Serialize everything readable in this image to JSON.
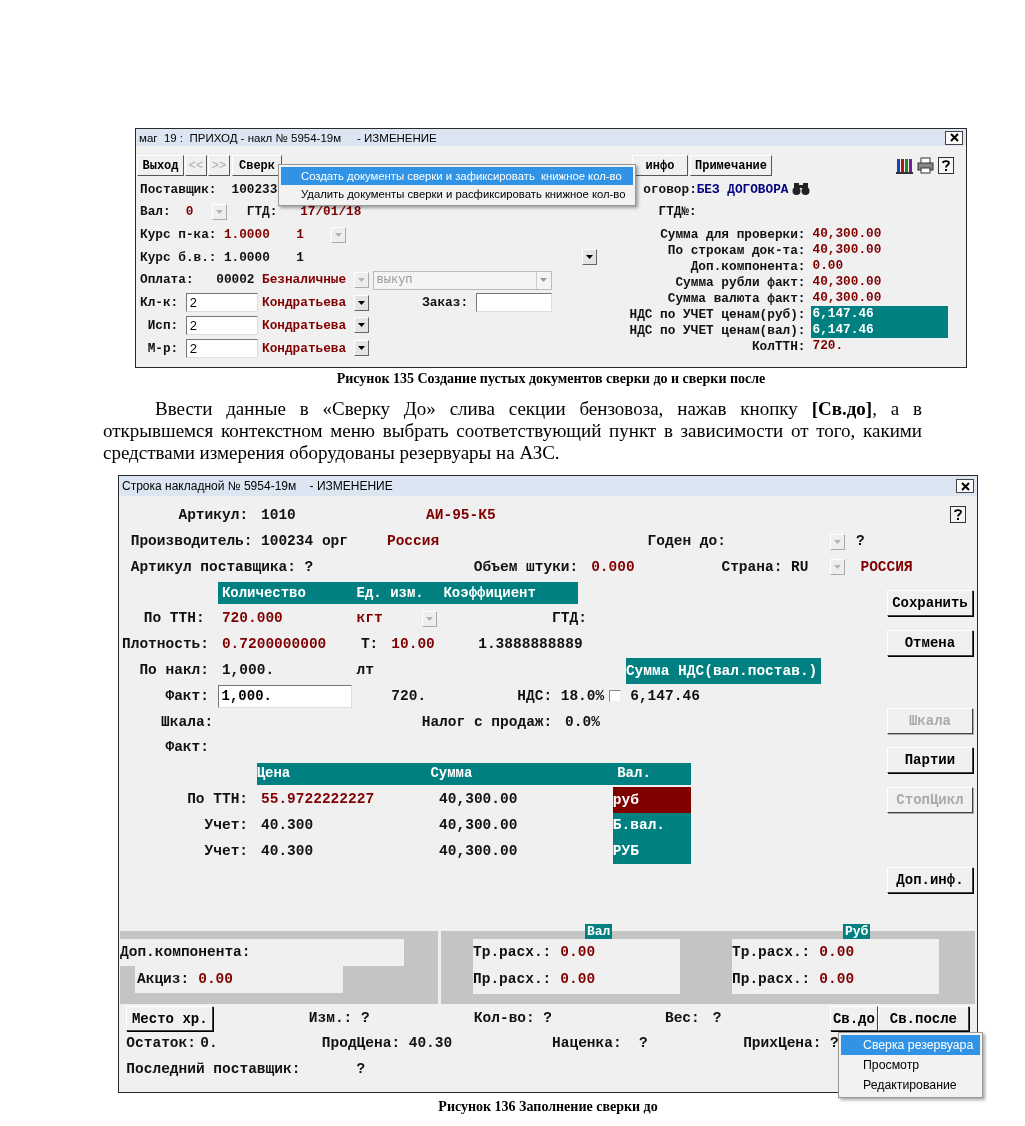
{
  "figure_1": {
    "window": {
      "title": "маг  19 :  ПРИХОД - накл № 5954-19м     - ИЗМЕНЕНИЕ"
    },
    "toolbar": [
      {
        "label": "Выход",
        "disabled": false
      },
      {
        "label": "<<",
        "disabled": true
      },
      {
        "label": ">>",
        "disabled": true
      },
      {
        "label": "Сверк",
        "disabled": false
      },
      {
        "label": "инфо",
        "disabled": false
      },
      {
        "label": "Примечание",
        "disabled": false
      }
    ],
    "context_menu": [
      {
        "label": "Создать документы сверки и зафиксировать  книжное кол-во",
        "selected": true
      },
      {
        "label": "Удалить документы сверки и расфиксировать книжное кол-во",
        "selected": false
      }
    ],
    "form_rows": [
      [
        {
          "kind": "label",
          "text": "Поставщик:"
        },
        {
          "kind": "value",
          "text": "100233"
        },
        {
          "kind": "label",
          "text": "оговор:"
        },
        {
          "kind": "emphasis",
          "text": "БЕЗ ДОГОВОРА"
        }
      ],
      [
        {
          "kind": "label",
          "text": "Вал:"
        },
        {
          "kind": "accent",
          "text": "0"
        },
        {
          "kind": "combo",
          "disabled": true
        },
        {
          "kind": "label",
          "text": "ГТД:"
        },
        {
          "kind": "accent",
          "text": "17/01/18"
        },
        {
          "kind": "label",
          "text": "ГТД№:"
        }
      ],
      [
        {
          "kind": "label",
          "text": "Курс п-ка:"
        },
        {
          "kind": "accent",
          "text": "1.0000"
        },
        {
          "kind": "accent",
          "text": "1"
        },
        {
          "kind": "combo",
          "disabled": true
        }
      ],
      [
        {
          "kind": "label",
          "text": "Курс б.в.:"
        },
        {
          "kind": "value",
          "text": "1.0000"
        },
        {
          "kind": "value",
          "text": "1"
        },
        {
          "kind": "combo",
          "disabled": false
        }
      ],
      [
        {
          "kind": "label",
          "text": "Оплата:"
        },
        {
          "kind": "value",
          "text": "00002"
        },
        {
          "kind": "accent",
          "text": "Безналичные"
        },
        {
          "kind": "combo",
          "disabled": true
        },
        {
          "kind": "select",
          "value": "выкуп",
          "disabled": true
        }
      ],
      [
        {
          "kind": "label",
          "text": "Кл-к:"
        },
        {
          "kind": "field",
          "value": "2"
        },
        {
          "kind": "accent",
          "text": "Кондратьева"
        },
        {
          "kind": "combo",
          "disabled": false
        },
        {
          "kind": "label",
          "text": "Заказ:"
        },
        {
          "kind": "field"
        }
      ],
      [
        {
          "kind": "label",
          "text": "Исп:"
        },
        {
          "kind": "field",
          "value": "2"
        },
        {
          "kind": "accent",
          "text": "Кондратьева"
        },
        {
          "kind": "combo",
          "disabled": false
        }
      ],
      [
        {
          "kind": "label",
          "text": "М-р:"
        },
        {
          "kind": "field",
          "value": "2"
        },
        {
          "kind": "accent",
          "text": "Кондратьева"
        },
        {
          "kind": "combo",
          "disabled": false
        }
      ]
    ],
    "totals": [
      {
        "label": "Сумма для проверки:",
        "value": "40,300.00",
        "highlighted": false
      },
      {
        "label": "По строкам док-та:",
        "value": "40,300.00",
        "highlighted": false
      },
      {
        "label": "Доп.компонента:",
        "value": "0.00",
        "highlighted": false
      },
      {
        "label": "Сумма рубли факт:",
        "value": "40,300.00",
        "highlighted": false
      },
      {
        "label": "Сумма валюта факт:",
        "value": "40,300.00",
        "highlighted": false
      },
      {
        "label": "НДС по УЧЕТ ценам(руб):",
        "value": "6,147.46",
        "highlighted": true
      },
      {
        "label": "НДС по УЧЕТ ценам(вал):",
        "value": "6,147.46",
        "highlighted": true
      },
      {
        "label": "КолТТН:",
        "value": "720.",
        "highlighted": false
      }
    ]
  },
  "caption_1": "Рисунок 135 Создание пустых документов сверки до и сверки после",
  "paragraph": "Ввести данные в «Сверку До» слива секции бензовоза, нажав кнопку **[Св.до]**, а в открывшемся контекстном меню выбрать соответствующий пункт в зависимости от того, какими средствами измерения оборудованы резервуары на АЗС.",
  "figure_2": {
    "window": {
      "title": "Строка накладной № 5954-19м    - ИЗМЕНЕНИЕ"
    },
    "form_rows": [
      [
        {
          "kind": "label",
          "text": "Артикул:"
        },
        {
          "kind": "value",
          "text": "1010"
        },
        {
          "kind": "accent",
          "text": "АИ-95-К5"
        }
      ],
      [
        {
          "kind": "label",
          "text": "Производитель:"
        },
        {
          "kind": "value",
          "text": "100234 орг"
        },
        {
          "kind": "accent",
          "text": "Россия"
        },
        {
          "kind": "label",
          "text": "Годен до:"
        },
        {
          "kind": "combo",
          "disabled": true
        },
        {
          "kind": "value",
          "text": "?"
        }
      ],
      [
        {
          "kind": "label",
          "text": "Артикул поставщика:"
        },
        {
          "kind": "value",
          "text": "?"
        },
        {
          "kind": "label",
          "text": "Объем штуки:"
        },
        {
          "kind": "accent",
          "text": "0.000"
        },
        {
          "kind": "label",
          "text": "Страна:"
        },
        {
          "kind": "value",
          "text": "RU"
        },
        {
          "kind": "combo",
          "disabled": true
        },
        {
          "kind": "accent",
          "text": "РОССИЯ"
        }
      ],
      [
        {
          "kind": "header",
          "cells": [
            "Количество",
            "Ед. изм.",
            "Коэффициент"
          ]
        }
      ],
      [
        {
          "kind": "label",
          "text": "По ТТН:"
        },
        {
          "kind": "accent",
          "text": "720.000"
        },
        {
          "kind": "accent",
          "text": "кгт"
        },
        {
          "kind": "combo",
          "disabled": true
        },
        {
          "kind": "label",
          "text": "ГТД:"
        }
      ],
      [
        {
          "kind": "label",
          "text": "Плотность:"
        },
        {
          "kind": "accent",
          "text": "0.7200000000"
        },
        {
          "kind": "label",
          "text": "Т:"
        },
        {
          "kind": "accent",
          "text": "10.00"
        },
        {
          "kind": "value",
          "text": "1.3888888889"
        }
      ],
      [
        {
          "kind": "label",
          "text": "По накл:"
        },
        {
          "kind": "value",
          "text": "1,000."
        },
        {
          "kind": "value",
          "text": "лт"
        },
        {
          "kind": "tag",
          "text": "Сумма НДС(вал.постав.)",
          "color": "#008080"
        }
      ],
      [
        {
          "kind": "label",
          "text": "Факт:"
        },
        {
          "kind": "field",
          "value": "1,000."
        },
        {
          "kind": "value",
          "text": "720."
        },
        {
          "kind": "label",
          "text": "НДС:"
        },
        {
          "kind": "value",
          "text": "18.0%"
        },
        {
          "kind": "checkbox",
          "checked": false
        },
        {
          "kind": "value",
          "text": "6,147.46"
        }
      ],
      [
        {
          "kind": "label",
          "text": "Шкала:"
        },
        {
          "kind": "label",
          "text": "Налог с продаж:"
        },
        {
          "kind": "value",
          "text": "0.0%"
        }
      ],
      [
        {
          "kind": "label",
          "text": "Факт:"
        }
      ],
      [
        {
          "kind": "header",
          "cells": [
            "Цена",
            "Сумма",
            "Вал."
          ]
        }
      ],
      [
        {
          "kind": "label",
          "text": "По ТТН:"
        },
        {
          "kind": "accent",
          "text": "55.9722222227"
        },
        {
          "kind": "value",
          "text": "40,300.00"
        },
        {
          "kind": "tag",
          "text": "руб",
          "color": "#800000"
        }
      ],
      [
        {
          "kind": "label",
          "text": "Учет:"
        },
        {
          "kind": "value",
          "text": "40.300"
        },
        {
          "kind": "value",
          "text": "40,300.00"
        },
        {
          "kind": "tag",
          "text": "Б.вал.",
          "color": "#008080"
        }
      ],
      [
        {
          "kind": "label",
          "text": "Учет:"
        },
        {
          "kind": "value",
          "text": "40.300"
        },
        {
          "kind": "value",
          "text": "40,300.00"
        },
        {
          "kind": "tag",
          "text": "РУБ",
          "color": "#008080"
        }
      ]
    ],
    "buttons": [
      {
        "label": "Сохранить",
        "disabled": false
      },
      {
        "label": "Отмена",
        "disabled": false
      },
      {
        "label": "Шкала",
        "disabled": true
      },
      {
        "label": "Партии",
        "disabled": false
      },
      {
        "label": "СтопЦикл",
        "disabled": true
      },
      {
        "label": "Доп.инф.",
        "disabled": false
      }
    ],
    "components": {
      "label": "Доп.компонента:",
      "excise": {
        "label": "Акциз:",
        "value": "0.00"
      }
    },
    "costs": [
      {
        "currency": "Вал",
        "rows": [
          {
            "label": "Тр.расх.:",
            "value": "0.00"
          },
          {
            "label": "Пр.расх.:",
            "value": "0.00"
          }
        ]
      },
      {
        "currency": "Руб",
        "rows": [
          {
            "label": "Тр.расх.:",
            "value": "0.00"
          },
          {
            "label": "Пр.расх.:",
            "value": "0.00"
          }
        ]
      }
    ],
    "footer_rows": [
      [
        {
          "kind": "button",
          "label": "Место хр.",
          "disabled": false
        },
        {
          "kind": "label",
          "text": "Изм.:"
        },
        {
          "kind": "value",
          "text": "?"
        },
        {
          "kind": "label",
          "text": "Кол-во:"
        },
        {
          "kind": "value",
          "text": "?"
        },
        {
          "kind": "label",
          "text": "Вес:"
        },
        {
          "kind": "value",
          "text": "?"
        },
        {
          "kind": "button",
          "label": "Св.до",
          "disabled": false
        },
        {
          "kind": "button",
          "label": "Св.после",
          "disabled": false
        }
      ],
      [
        {
          "kind": "label",
          "text": "Остаток:"
        },
        {
          "kind": "value",
          "text": "0."
        },
        {
          "kind": "label",
          "text": "ПродЦена:"
        },
        {
          "kind": "value",
          "text": "40.30"
        },
        {
          "kind": "label",
          "text": "Наценка:"
        },
        {
          "kind": "value",
          "text": "?"
        },
        {
          "kind": "label",
          "text": "ПрихЦена:"
        },
        {
          "kind": "value",
          "text": "?"
        }
      ],
      [
        {
          "kind": "label",
          "text": "Последний поставщик:"
        },
        {
          "kind": "value",
          "text": "?"
        }
      ]
    ],
    "context_menu": [
      {
        "label": "Сверка резервуара",
        "selected": true
      },
      {
        "label": "Просмотр",
        "selected": false
      },
      {
        "label": "Редактирование",
        "selected": false
      }
    ]
  },
  "caption_2": "Рисунок 136 Заполнение сверки до"
}
